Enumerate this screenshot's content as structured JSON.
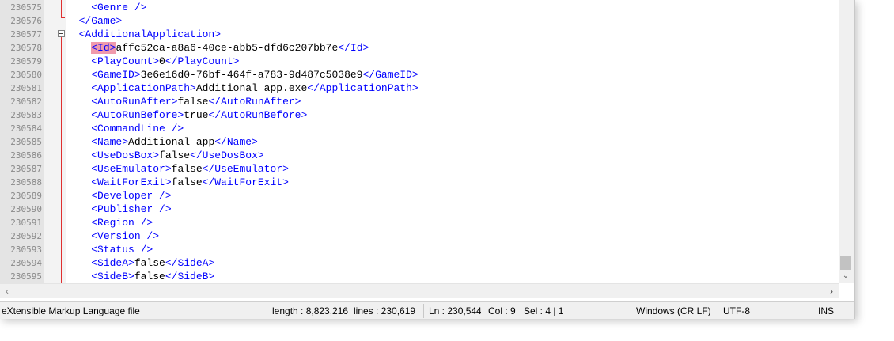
{
  "editor": {
    "lines": [
      {
        "num": "230575",
        "indent": 2,
        "parts": [
          {
            "t": "tag",
            "v": "<Genre />"
          }
        ]
      },
      {
        "num": "230576",
        "indent": 1,
        "parts": [
          {
            "t": "tag",
            "v": "</Game>"
          }
        ]
      },
      {
        "num": "230577",
        "indent": 1,
        "parts": [
          {
            "t": "tag",
            "v": "<AdditionalApplication>"
          }
        ]
      },
      {
        "num": "230578",
        "indent": 2,
        "parts": [
          {
            "t": "hl",
            "v": "<Id>"
          },
          {
            "t": "text",
            "v": "affc52ca-a8a6-40ce-abb5-dfd6c207bb7e"
          },
          {
            "t": "tag",
            "v": "</Id>"
          }
        ]
      },
      {
        "num": "230579",
        "indent": 2,
        "parts": [
          {
            "t": "tag",
            "v": "<PlayCount>"
          },
          {
            "t": "text",
            "v": "0"
          },
          {
            "t": "tag",
            "v": "</PlayCount>"
          }
        ]
      },
      {
        "num": "230580",
        "indent": 2,
        "parts": [
          {
            "t": "tag",
            "v": "<GameID>"
          },
          {
            "t": "text",
            "v": "3e6e16d0-76bf-464f-a783-9d487c5038e9"
          },
          {
            "t": "tag",
            "v": "</GameID>"
          }
        ]
      },
      {
        "num": "230581",
        "indent": 2,
        "parts": [
          {
            "t": "tag",
            "v": "<ApplicationPath>"
          },
          {
            "t": "text",
            "v": "Additional app.exe"
          },
          {
            "t": "tag",
            "v": "</ApplicationPath>"
          }
        ]
      },
      {
        "num": "230582",
        "indent": 2,
        "parts": [
          {
            "t": "tag",
            "v": "<AutoRunAfter>"
          },
          {
            "t": "text",
            "v": "false"
          },
          {
            "t": "tag",
            "v": "</AutoRunAfter>"
          }
        ]
      },
      {
        "num": "230583",
        "indent": 2,
        "parts": [
          {
            "t": "tag",
            "v": "<AutoRunBefore>"
          },
          {
            "t": "text",
            "v": "true"
          },
          {
            "t": "tag",
            "v": "</AutoRunBefore>"
          }
        ]
      },
      {
        "num": "230584",
        "indent": 2,
        "parts": [
          {
            "t": "tag",
            "v": "<CommandLine />"
          }
        ]
      },
      {
        "num": "230585",
        "indent": 2,
        "parts": [
          {
            "t": "tag",
            "v": "<Name>"
          },
          {
            "t": "text",
            "v": "Additional app"
          },
          {
            "t": "tag",
            "v": "</Name>"
          }
        ]
      },
      {
        "num": "230586",
        "indent": 2,
        "parts": [
          {
            "t": "tag",
            "v": "<UseDosBox>"
          },
          {
            "t": "text",
            "v": "false"
          },
          {
            "t": "tag",
            "v": "</UseDosBox>"
          }
        ]
      },
      {
        "num": "230587",
        "indent": 2,
        "parts": [
          {
            "t": "tag",
            "v": "<UseEmulator>"
          },
          {
            "t": "text",
            "v": "false"
          },
          {
            "t": "tag",
            "v": "</UseEmulator>"
          }
        ]
      },
      {
        "num": "230588",
        "indent": 2,
        "parts": [
          {
            "t": "tag",
            "v": "<WaitForExit>"
          },
          {
            "t": "text",
            "v": "false"
          },
          {
            "t": "tag",
            "v": "</WaitForExit>"
          }
        ]
      },
      {
        "num": "230589",
        "indent": 2,
        "parts": [
          {
            "t": "tag",
            "v": "<Developer />"
          }
        ]
      },
      {
        "num": "230590",
        "indent": 2,
        "parts": [
          {
            "t": "tag",
            "v": "<Publisher />"
          }
        ]
      },
      {
        "num": "230591",
        "indent": 2,
        "parts": [
          {
            "t": "tag",
            "v": "<Region />"
          }
        ]
      },
      {
        "num": "230592",
        "indent": 2,
        "parts": [
          {
            "t": "tag",
            "v": "<Version />"
          }
        ]
      },
      {
        "num": "230593",
        "indent": 2,
        "parts": [
          {
            "t": "tag",
            "v": "<Status />"
          }
        ]
      },
      {
        "num": "230594",
        "indent": 2,
        "parts": [
          {
            "t": "tag",
            "v": "<SideA>"
          },
          {
            "t": "text",
            "v": "false"
          },
          {
            "t": "tag",
            "v": "</SideA>"
          }
        ]
      },
      {
        "num": "230595",
        "indent": 2,
        "parts": [
          {
            "t": "tag",
            "v": "<SideB>"
          },
          {
            "t": "text",
            "v": "false"
          },
          {
            "t": "tag",
            "v": "</SideB>"
          }
        ]
      }
    ],
    "bookmark_line": "230578",
    "colors": {
      "tag": "#0000ff",
      "text": "#000000",
      "highlight": "#f09aac",
      "fold": "#e03030",
      "bookmark": "#3c5fe0"
    },
    "icons": {
      "bookmark": "bookmark-marker-icon",
      "fold": "fold-minus-icon",
      "scroll_left": "chevron-left-icon",
      "scroll_right": "chevron-right-icon",
      "scroll_down": "chevron-down-icon"
    }
  },
  "statusbar": {
    "file_type": "eXtensible Markup Language file",
    "length": "length : 8,823,216",
    "lines": "lines : 230,619",
    "ln": "Ln : 230,544",
    "col": "Col : 9",
    "sel": "Sel : 4 | 1",
    "eol": "Windows (CR LF)",
    "encoding": "UTF-8",
    "mode": "INS"
  }
}
